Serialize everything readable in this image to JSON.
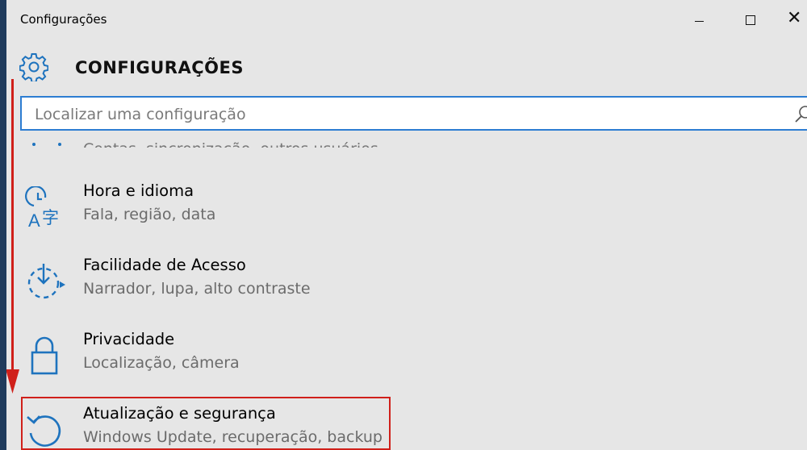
{
  "window": {
    "title": "Configurações",
    "close_glyph": "✕"
  },
  "header": {
    "title": "CONFIGURAÇÕES",
    "icon": "gear-icon"
  },
  "search": {
    "placeholder": "Localizar uma configuração",
    "value": "",
    "icon": "search-icon"
  },
  "items": [
    {
      "label": "",
      "desc": "Contas, sincronização, outros usuários",
      "icon": "accounts-icon"
    },
    {
      "label": "Hora e idioma",
      "desc": "Fala, região, data",
      "icon": "time-language-icon"
    },
    {
      "label": "Facilidade de Acesso",
      "desc": "Narrador, lupa, alto contraste",
      "icon": "ease-of-access-icon"
    },
    {
      "label": "Privacidade",
      "desc": "Localização, câmera",
      "icon": "lock-icon"
    },
    {
      "label": "Atualização e segurança",
      "desc": "Windows Update, recuperação, backup",
      "icon": "update-icon"
    }
  ],
  "colors": {
    "accent": "#1e73be",
    "annotation": "#d0201a",
    "background": "#e6e6e6"
  }
}
